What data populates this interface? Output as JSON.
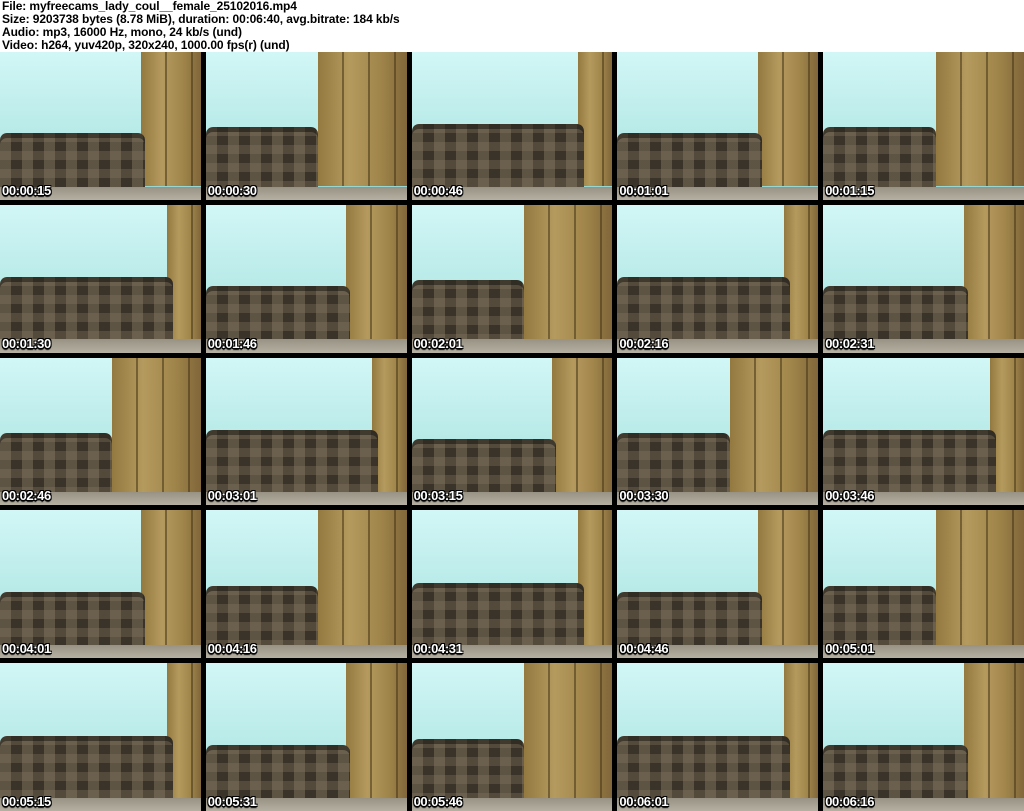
{
  "header": {
    "lines": [
      "File: myfreecams_lady_coul__female_25102016.mp4",
      "Size: 9203738 bytes (8.78 MiB), duration: 00:06:40, avg.bitrate: 184 kb/s",
      "Audio: mp3, 16000 Hz, mono, 24 kb/s (und)",
      "Video: h264, yuv420p, 320x240, 1000.00 fps(r) (und)"
    ]
  },
  "grid": {
    "rows": 5,
    "columns": 5,
    "thumbnails": [
      {
        "timestamp": "00:00:15"
      },
      {
        "timestamp": "00:00:30"
      },
      {
        "timestamp": "00:00:46"
      },
      {
        "timestamp": "00:01:01"
      },
      {
        "timestamp": "00:01:15"
      },
      {
        "timestamp": "00:01:30"
      },
      {
        "timestamp": "00:01:46"
      },
      {
        "timestamp": "00:02:01"
      },
      {
        "timestamp": "00:02:16"
      },
      {
        "timestamp": "00:02:31"
      },
      {
        "timestamp": "00:02:46"
      },
      {
        "timestamp": "00:03:01"
      },
      {
        "timestamp": "00:03:15"
      },
      {
        "timestamp": "00:03:30"
      },
      {
        "timestamp": "00:03:46"
      },
      {
        "timestamp": "00:04:01"
      },
      {
        "timestamp": "00:04:16"
      },
      {
        "timestamp": "00:04:31"
      },
      {
        "timestamp": "00:04:46"
      },
      {
        "timestamp": "00:05:01"
      },
      {
        "timestamp": "00:05:15"
      },
      {
        "timestamp": "00:05:31"
      },
      {
        "timestamp": "00:05:46"
      },
      {
        "timestamp": "00:06:01"
      },
      {
        "timestamp": "00:06:16"
      }
    ]
  },
  "colors": {
    "header_bg": "#ffffff",
    "header_text": "#000000",
    "grid_gap": "#000000",
    "wall": "#c2efee",
    "wardrobe": "#a3854c",
    "couch": "#3a332a",
    "floor": "#aaa496",
    "timestamp_text": "#ffffff",
    "timestamp_outline": "#000000"
  }
}
